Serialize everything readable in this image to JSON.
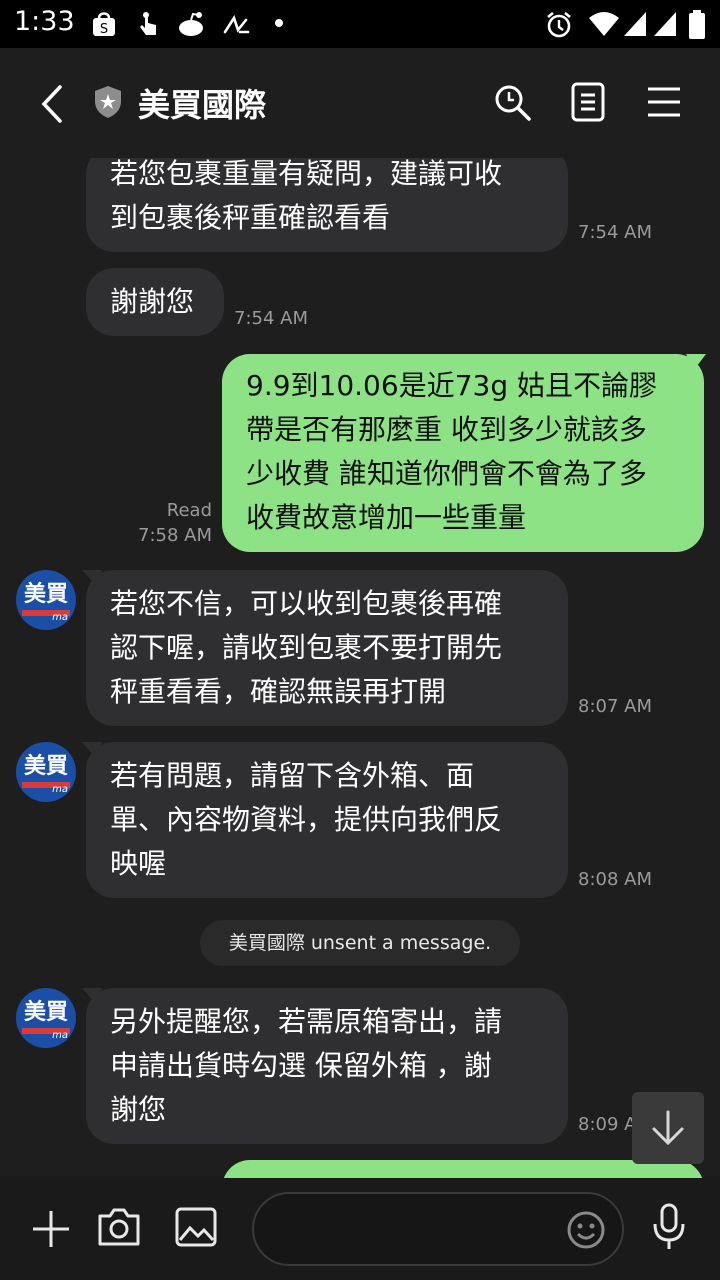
{
  "status_bar": {
    "time": "1:33"
  },
  "header": {
    "title": "美買國際"
  },
  "messages": [
    {
      "side": "in",
      "lines": [
        "若您包裹重量有疑問，建議可收",
        "到包裹後秤重確認看看"
      ],
      "time": "7:54 AM"
    },
    {
      "side": "in",
      "lines": [
        "謝謝您"
      ],
      "time": "7:54 AM"
    },
    {
      "side": "out",
      "lines": [
        "9.9到10.06是近73g 姑且不論膠",
        "帶是否有那麼重 收到多少就該多",
        "少收費 誰知道你們會不會為了多",
        "收費故意增加一些重量"
      ],
      "read": "Read",
      "time": "7:58 AM"
    },
    {
      "side": "in",
      "lines": [
        "若您不信，可以收到包裹後再確",
        "認下喔，請收到包裹不要打開先",
        "秤重看看，確認無誤再打開"
      ],
      "time": "8:07 AM"
    },
    {
      "side": "in",
      "lines": [
        "若有問題，請留下含外箱、面",
        "單、內容物資料，提供向我們反",
        "映喔"
      ],
      "time": "8:08 AM"
    },
    {
      "side": "in",
      "lines": [
        "另外提醒您，若需原箱寄出，請",
        "申請出貨時勾選 保留外箱 ，謝",
        "謝您"
      ],
      "time": "8:09 AM"
    }
  ],
  "system_message": "美買國際 unsent a message.",
  "avatar": {
    "text": "美買",
    "sub": "ma"
  },
  "colors": {
    "incoming_bubble": "#2f2f31",
    "outgoing_bubble": "#8de286",
    "background": "#1e1e1e"
  }
}
